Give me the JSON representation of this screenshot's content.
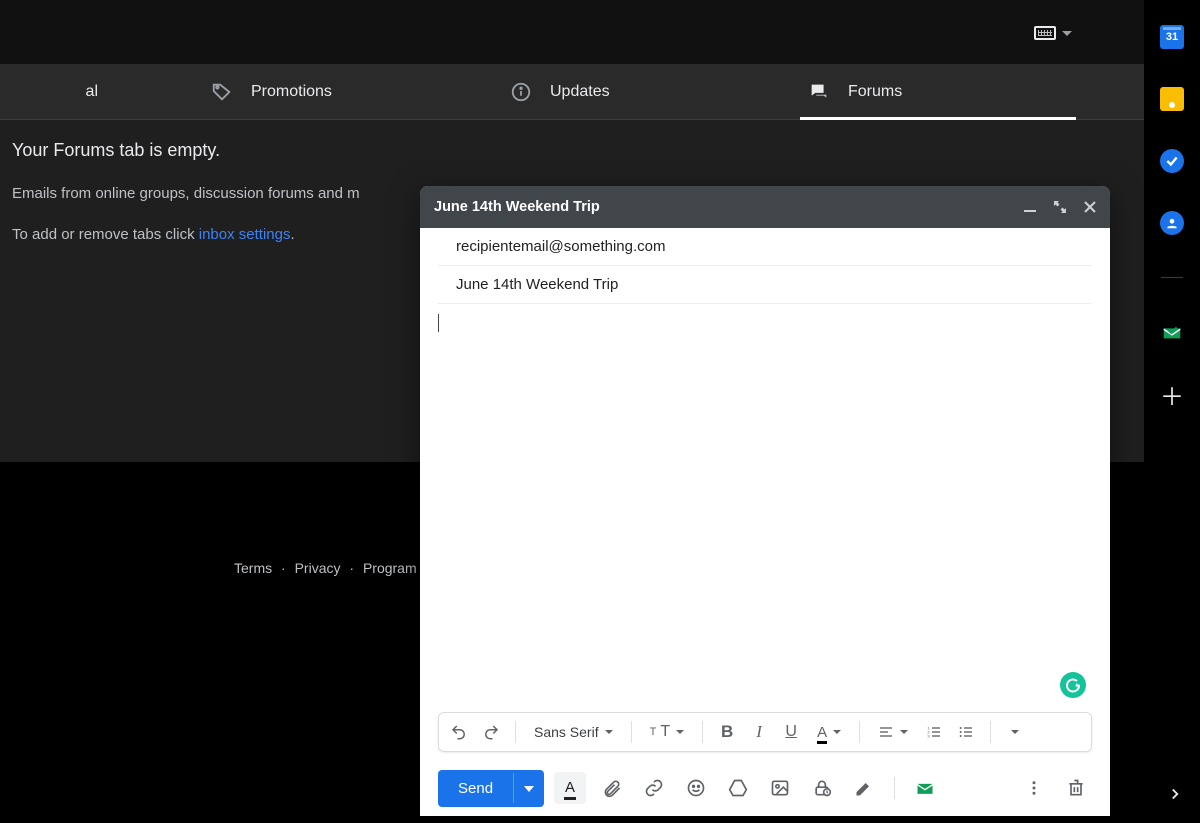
{
  "topbar": {},
  "tabs": {
    "social_label": "al",
    "promotions_label": "Promotions",
    "updates_label": "Updates",
    "forums_label": "Forums",
    "active": "forums"
  },
  "empty_state": {
    "heading": "Your Forums tab is empty.",
    "line1": "Emails from online groups, discussion forums and m",
    "line2_prefix": "To add or remove tabs click ",
    "link_text": "inbox settings",
    "line2_suffix": "."
  },
  "footer": {
    "terms": "Terms",
    "privacy": "Privacy",
    "program": "Program"
  },
  "sidepanel": {
    "calendar_day": "31"
  },
  "compose": {
    "title": "June 14th Weekend Trip",
    "to": "recipientemail@something.com",
    "subject": "June 14th Weekend Trip",
    "body": "",
    "font_family_label": "Sans Serif",
    "send_label": "Send"
  }
}
